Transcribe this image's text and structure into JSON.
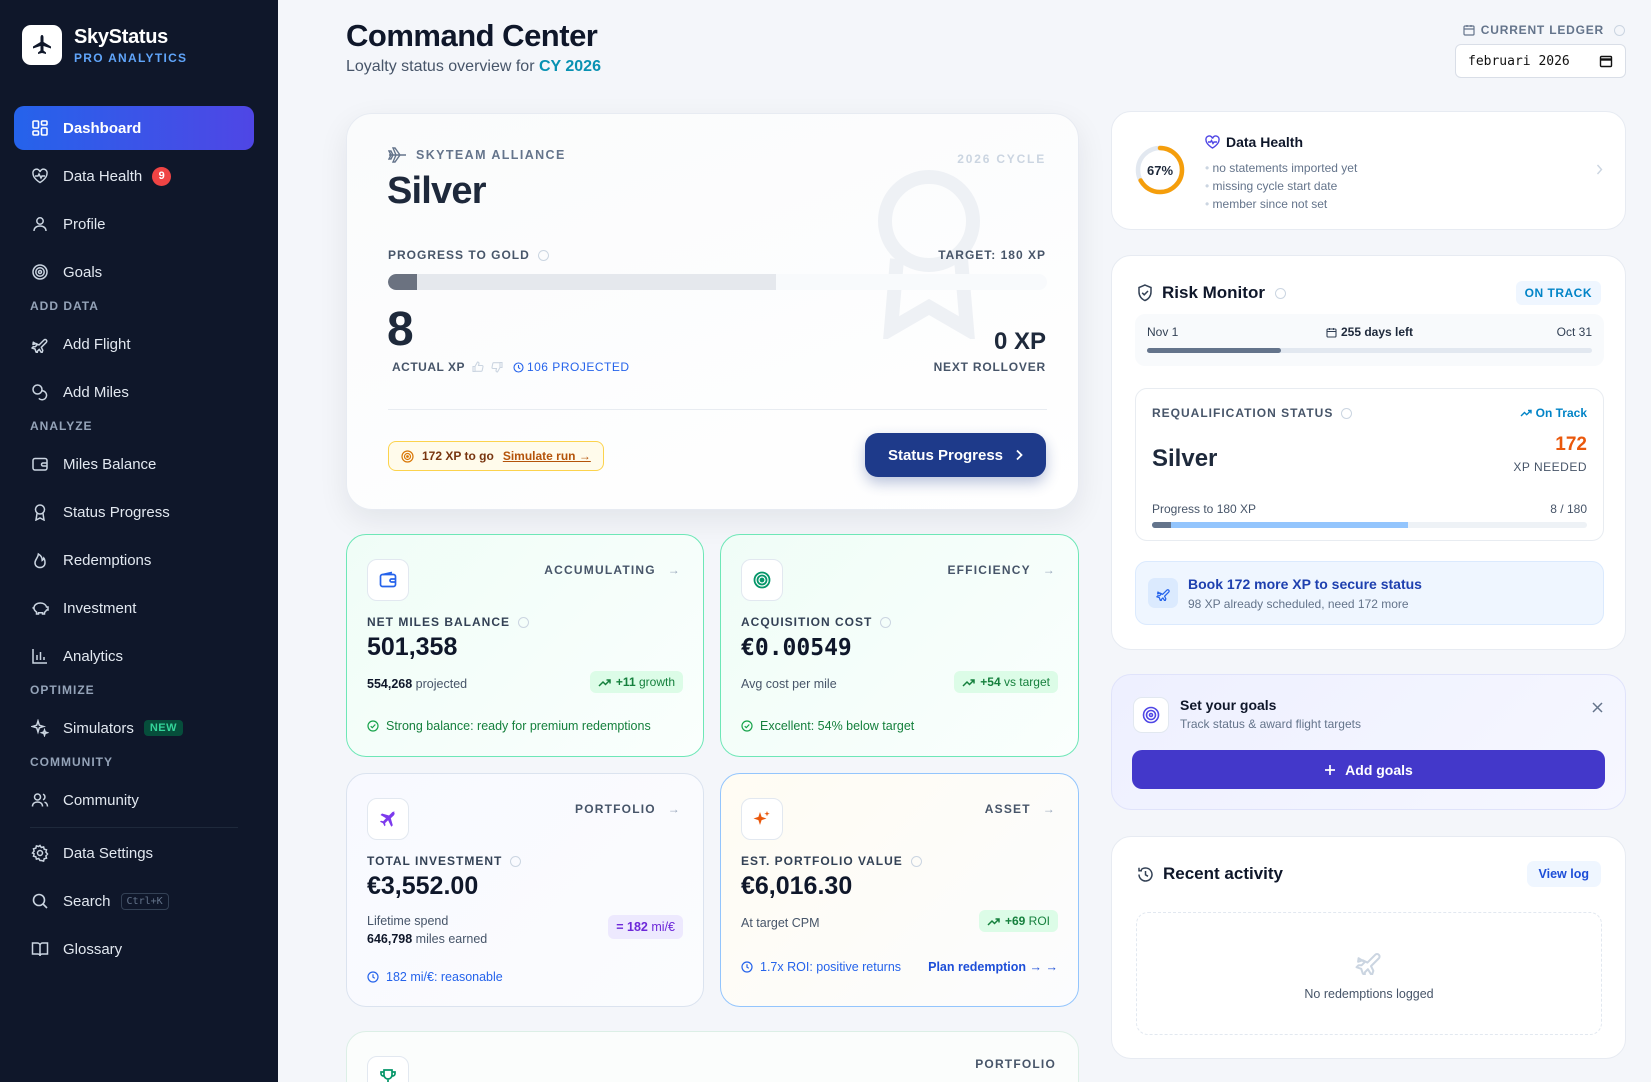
{
  "brand": {
    "title": "SkyStatus",
    "subtitle": "PRO ANALYTICS"
  },
  "nav": {
    "dashboard": "Dashboard",
    "data_health": "Data Health",
    "data_health_badge": "9",
    "profile": "Profile",
    "goals": "Goals",
    "sec_add": "ADD DATA",
    "add_flight": "Add Flight",
    "add_miles": "Add Miles",
    "sec_analyze": "ANALYZE",
    "miles_balance": "Miles Balance",
    "status_progress": "Status Progress",
    "redemptions": "Redemptions",
    "investment": "Investment",
    "analytics": "Analytics",
    "sec_optimize": "OPTIMIZE",
    "simulators": "Simulators",
    "simulators_badge": "NEW",
    "sec_community": "COMMUNITY",
    "community": "Community",
    "data_settings": "Data Settings",
    "search": "Search",
    "search_kbd": "Ctrl+K",
    "glossary": "Glossary"
  },
  "header": {
    "title": "Command Center",
    "subtitle_prefix": "Loyalty status overview for",
    "subtitle_year": "CY 2026",
    "ledger_label": "CURRENT LEDGER",
    "ledger_value": "februari 2026"
  },
  "hero": {
    "alliance": "SKYTEAM ALLIANCE",
    "cycle": "2026 CYCLE",
    "status": "Silver",
    "progress_label": "PROGRESS TO GOLD",
    "target": "TARGET: 180 XP",
    "progress_actual": 0.044,
    "progress_projected": 0.589,
    "actual_xp": "8",
    "actual_label": "ACTUAL XP",
    "projected": "106 PROJECTED",
    "rollover_value": "0 XP",
    "rollover_label": "NEXT ROLLOVER",
    "to_go": "172 XP to go",
    "simulate": "Simulate run →",
    "button": "Status Progress"
  },
  "metrics": {
    "net_miles": {
      "tag": "ACCUMULATING",
      "label": "NET MILES BALANCE",
      "value": "501,358",
      "sub_value": "554,268",
      "sub_text": "projected",
      "pill_value": "+11",
      "pill_text": "growth",
      "footer": "Strong balance: ready for premium redemptions"
    },
    "acq_cost": {
      "tag": "EFFICIENCY",
      "label": "ACQUISITION COST",
      "value": "€0.00549",
      "sub_text": "Avg cost per mile",
      "pill_value": "+54",
      "pill_text": "vs target",
      "footer": "Excellent: 54% below target"
    },
    "investment": {
      "tag": "PORTFOLIO",
      "label": "TOTAL INVESTMENT",
      "value": "€3,552.00",
      "sub_text": "Lifetime spend",
      "sub2_value": "646,798",
      "sub2_text": "miles earned",
      "pill_value": "= 182",
      "pill_text": "mi/€",
      "footer": "182 mi/€: reasonable"
    },
    "portfolio": {
      "tag": "ASSET",
      "label": "EST. PORTFOLIO VALUE",
      "value": "€6,016.30",
      "sub_text": "At target CPM",
      "pill_value": "+69",
      "pill_text": "ROI",
      "footer": "1.7x ROI: positive returns",
      "link": "Plan redemption →"
    },
    "bottom": {
      "tag": "PORTFOLIO"
    }
  },
  "data_health": {
    "percent": "67%",
    "percent_value": 0.67,
    "title": "Data Health",
    "items": [
      "no statements imported yet",
      "missing cycle start date",
      "member since not set"
    ]
  },
  "risk": {
    "title": "Risk Monitor",
    "status": "ON TRACK",
    "start": "Nov 1",
    "days_left": "255 days left",
    "end": "Oct 31",
    "timeline_progress": 0.3,
    "req_label": "REQUALIFICATION STATUS",
    "req_status": "On Track",
    "req_tier": "Silver",
    "xp_needed": "172",
    "xp_needed_label": "XP NEEDED",
    "progress_text": "Progress to 180 XP",
    "progress_count": "8 / 180",
    "req_actual": 0.044,
    "req_projected": 0.589,
    "cta_title": "Book 172 more XP to secure status",
    "cta_sub": "98 XP already scheduled, need 172 more"
  },
  "goals": {
    "title": "Set your goals",
    "subtitle": "Track status & award flight targets",
    "button": "Add goals"
  },
  "activity": {
    "title": "Recent activity",
    "view_log": "View log",
    "empty": "No redemptions logged"
  },
  "colors": {
    "sidebar": "#0f172a",
    "accent": "#4f46e5",
    "navy": "#1e3a8a",
    "green": "#10b981",
    "amber": "#f59e0b"
  }
}
